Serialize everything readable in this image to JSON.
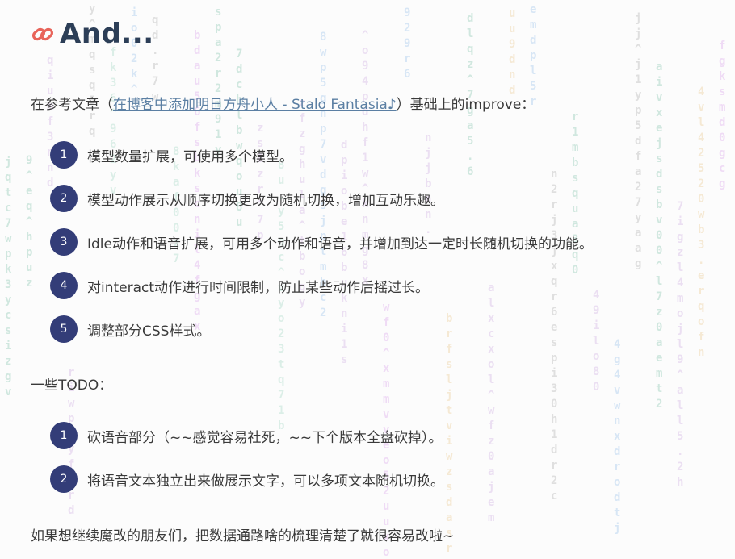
{
  "heading": {
    "icon": "link-icon",
    "text": "And..."
  },
  "intro": {
    "prefix": "在参考文章（",
    "link_text": "在博客中添加明日方舟小人 - Stalo Fantasia♪",
    "suffix": "）基础上的improve："
  },
  "improvements": [
    {
      "number": "1",
      "text": "模型数量扩展，可使用多个模型。"
    },
    {
      "number": "2",
      "text": "模型动作展示从顺序切换更改为随机切换，增加互动乐趣。"
    },
    {
      "number": "3",
      "text": "Idle动作和语音扩展，可用多个动作和语音，并增加到达一定时长随机切换的功能。"
    },
    {
      "number": "4",
      "text": "对interact动作进行时间限制，防止某些动作后摇过长。"
    },
    {
      "number": "5",
      "text": "调整部分CSS样式。"
    }
  ],
  "todo_heading": "一些TODO：",
  "todos": [
    {
      "number": "1",
      "text": "砍语音部分（~~感觉容易社死，~~下个版本全盘砍掉）。"
    },
    {
      "number": "2",
      "text": "将语音文本独立出来做展示文字，可以多项文本随机切换。"
    }
  ],
  "closing": "如果想继续魔改的朋友们，把数据通路啥的梳理清楚了就很容易改啦~",
  "colors": {
    "heading": "#2c3e57",
    "number_badge": "#333d78",
    "link": "#5b7fa3",
    "link_icon": "#e8645a"
  }
}
